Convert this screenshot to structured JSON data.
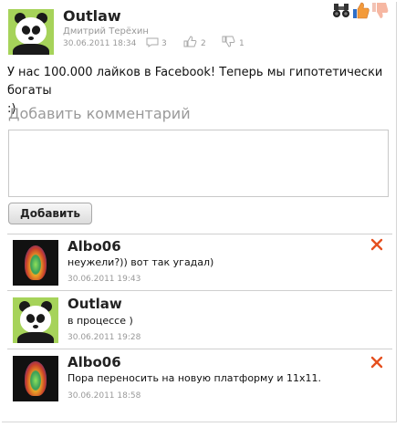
{
  "post": {
    "author": "Outlaw",
    "subtitle": "Дмитрий Терёхин",
    "date": "30.06.2011 18:34",
    "comments": "3",
    "likes": "2",
    "dislikes": "1",
    "text_line1": "У нас 100.000 лайков в Facebook! Теперь мы гипотетически богаты",
    "text_line2": ":)"
  },
  "form": {
    "title": "Добавить комментарий",
    "textarea_value": "",
    "submit_label": "Добавить"
  },
  "comments": [
    {
      "author": "Albo06",
      "text": "неужели?)) вот так угадал)",
      "date": "30.06.2011 19:43",
      "avatar": "flame-avatar"
    },
    {
      "author": "Outlaw",
      "text": "в процессе )",
      "date": "30.06.2011 19:28",
      "avatar": "panda-avatar"
    },
    {
      "author": "Albo06",
      "text": "Пора переносить на новую платформу и 11x11.",
      "date": "30.06.2011 18:58",
      "avatar": "flame-avatar"
    }
  ],
  "colors": {
    "accent_x": "#e5501f",
    "thumb_orange": "#f39a3a",
    "panda_bg": "#a6d35a"
  },
  "icons": [
    "binoculars-icon",
    "thumb-up-icon",
    "thumb-down-icon",
    "comment-icon",
    "close-icon"
  ]
}
